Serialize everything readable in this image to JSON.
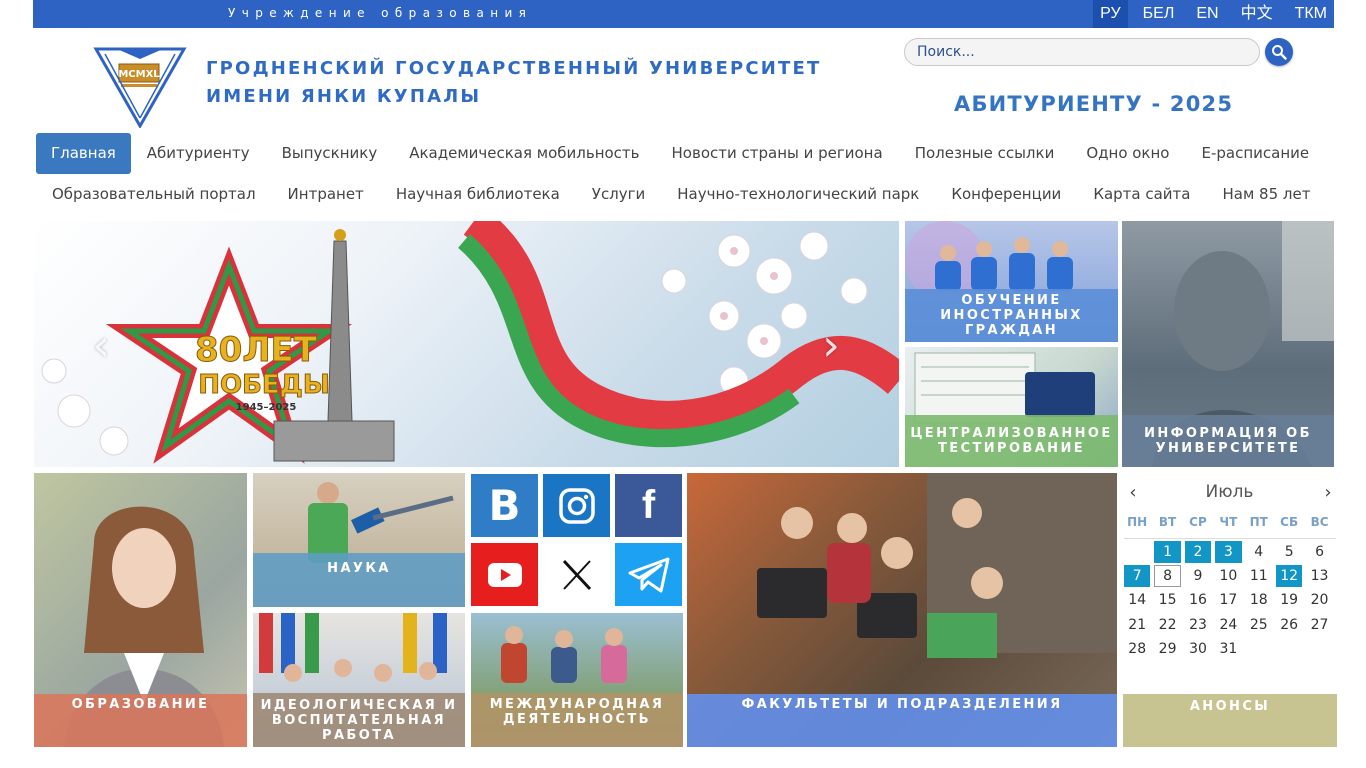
{
  "topbar": {
    "org_label": "Учреждение образования",
    "languages": [
      "РУ",
      "БЕЛ",
      "EN",
      "中文",
      "ТКМ"
    ],
    "active_language": "РУ"
  },
  "header": {
    "logo_text": "MCMXL",
    "university_name_line1": "ГРОДНЕНСКИЙ ГОСУДАРСТВЕННЫЙ УНИВЕРСИТЕТ",
    "university_name_line2": "ИМЕНИ ЯНКИ КУПАЛЫ",
    "search_placeholder": "Поиск...",
    "abiturient_banner": "АБИТУРИЕНТУ - 2025"
  },
  "nav": {
    "row1": [
      "Главная",
      "Абитуриенту",
      "Выпускнику",
      "Академическая мобильность",
      "Новости страны и региона",
      "Полезные ссылки",
      "Одно окно",
      "Е-расписание"
    ],
    "row2": [
      "Образовательный портал",
      "Интранет",
      "Научная библиотека",
      "Услуги",
      "Научно-технологический парк",
      "Конференции",
      "Карта сайта",
      "Нам 85 лет"
    ],
    "active": "Главная"
  },
  "slider": {
    "emblem_line1": "80ЛЕТ",
    "emblem_line2": "ПОБЕДЫ",
    "emblem_years": "1945–2025",
    "prev_icon": "chevron-left-icon",
    "next_icon": "chevron-right-icon"
  },
  "tiles": {
    "foreign": "ОБУЧЕНИЕ ИНОСТРАННЫХ ГРАЖДАН",
    "testing": "ЦЕНТРАЛИЗОВАННОЕ ТЕСТИРОВАНИЕ",
    "info": "ИНФОРМАЦИЯ ОБ УНИВЕРСИТЕТЕ",
    "education": "ОБРАЗОВАНИЕ",
    "science": "НАУКА",
    "ideology": "ИДЕОЛОГИЧЕСКАЯ И ВОСПИТАТЕЛЬНАЯ РАБОТА",
    "international": "МЕЖДУНАРОДНАЯ ДЕЯТЕЛЬНОСТЬ",
    "faculties": "ФАКУЛЬТЕТЫ И ПОДРАЗДЕЛЕНИЯ",
    "announcements": "АНОНСЫ"
  },
  "social": [
    {
      "name": "vk-icon",
      "color": "#2f7cc7"
    },
    {
      "name": "instagram-icon",
      "color": "#1a76c4"
    },
    {
      "name": "facebook-icon",
      "color": "#3b5998"
    },
    {
      "name": "youtube-icon",
      "color": "#e61e1e"
    },
    {
      "name": "x-icon",
      "color": "#ffffff"
    },
    {
      "name": "telegram-icon",
      "color": "#1da1f2"
    }
  ],
  "calendar": {
    "month": "Июль",
    "weekdays": [
      "ПН",
      "ВТ",
      "СР",
      "ЧТ",
      "ПТ",
      "СБ",
      "ВС"
    ],
    "first_weekday_offset": 1,
    "days_in_month": 31,
    "event_days": [
      1,
      2,
      3,
      7,
      12
    ],
    "today": 8
  },
  "colors": {
    "brand_blue": "#2e63c4",
    "cap_foreign": "#5b8ed8",
    "cap_testing": "#7cba6e",
    "cap_info": "#687e99",
    "cap_education": "#d9765b",
    "cap_science": "#5e9cc4",
    "cap_ideology": "#9e8a75",
    "cap_international": "#b29466",
    "cap_faculties": "#6391f0",
    "cap_announcements": "#c8c491",
    "calendar_event": "#1296c6"
  }
}
